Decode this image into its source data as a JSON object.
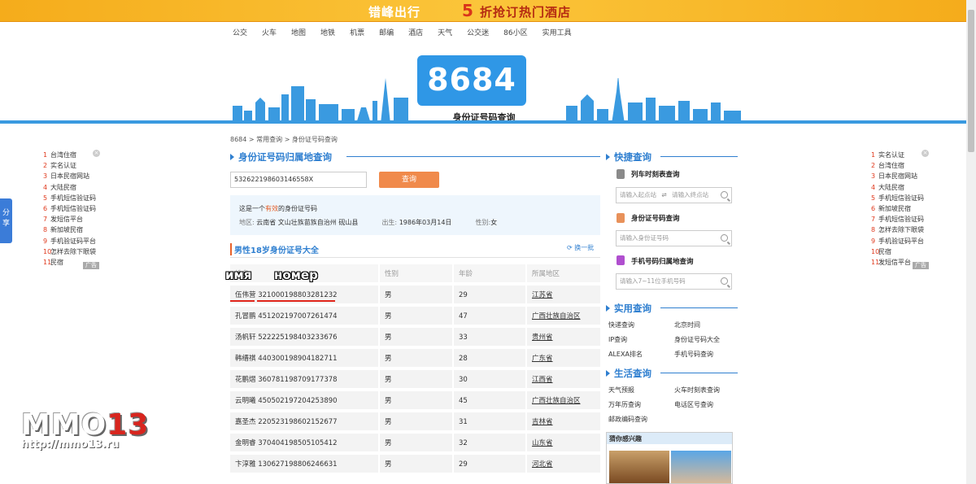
{
  "banner": {
    "part1": "错峰出行",
    "part2": "5",
    "part3": "折抢订热门酒店"
  },
  "nav": [
    "公交",
    "火车",
    "地图",
    "地铁",
    "机票",
    "邮编",
    "酒店",
    "天气",
    "公交迷",
    "86小区",
    "实用工具"
  ],
  "logo": {
    "text": "8684",
    "subtitle": "身份证号码查询"
  },
  "share": {
    "label1": "分",
    "label2": "享"
  },
  "left_panel": {
    "items": [
      "台湾住宿",
      "实名认证",
      "日本民宿网站",
      "大陆民宿",
      "手机短信验证码",
      "手机短信验证码",
      "发短信平台",
      "新加坡民宿",
      "手机验证码平台",
      "怎样去除下眼袋",
      "民宿"
    ],
    "numbers": [
      "1",
      "2",
      "3",
      "4",
      "5",
      "6",
      "7",
      "8",
      "9",
      "10",
      "11"
    ],
    "ad": "广告"
  },
  "right_panel": {
    "items": [
      "实名认证",
      "台湾住宿",
      "日本民宿网站",
      "大陆民宿",
      "手机短信验证码",
      "新加坡民宿",
      "手机短信验证码",
      "怎样去除下眼袋",
      "手机验证码平台",
      "民宿",
      "发短信平台"
    ],
    "numbers": [
      "1",
      "2",
      "3",
      "4",
      "5",
      "6",
      "7",
      "8",
      "9",
      "10",
      "11"
    ],
    "ad": "广告"
  },
  "breadcrumb": "8684 > 常用查询 > 身份证号码查询",
  "main": {
    "section_title": "身份证号码归属地查询",
    "input_value": "532622198603146558X",
    "query_button": "查询",
    "result": {
      "prefix": "这是一个",
      "valid": "有效",
      "suffix": "的身份证号码",
      "region_label": "地区:",
      "region_value": "云南省 文山壮族苗族自治州 砚山县",
      "birth_label": "出生:",
      "birth_value": "1986年03月14日",
      "gender_label": "性别:",
      "gender_value": "女"
    },
    "list_title": "男性18岁身份证号大全",
    "refresh": "换一批",
    "headers": [
      "姓名",
      "性别",
      "年龄",
      "所属地区"
    ],
    "rows": [
      {
        "name": "伍伟营",
        "id": "321000198803281232",
        "gender": "男",
        "age": "29",
        "region": "江苏省"
      },
      {
        "name": "孔冒鹏",
        "id": "451202197007261474",
        "gender": "男",
        "age": "47",
        "region": "广西壮族自治区"
      },
      {
        "name": "汤帆轩",
        "id": "522225198403233676",
        "gender": "男",
        "age": "33",
        "region": "贵州省"
      },
      {
        "name": "韩缙祺",
        "id": "440300198904182711",
        "gender": "男",
        "age": "28",
        "region": "广东省"
      },
      {
        "name": "花鹏熠",
        "id": "360781198709177378",
        "gender": "男",
        "age": "30",
        "region": "江西省"
      },
      {
        "name": "云明曦",
        "id": "450502197204253890",
        "gender": "男",
        "age": "45",
        "region": "广西壮族自治区"
      },
      {
        "name": "嘉圣杰",
        "id": "220523198602152677",
        "gender": "男",
        "age": "31",
        "region": "吉林省"
      },
      {
        "name": "金明睿",
        "id": "370404198505105412",
        "gender": "男",
        "age": "32",
        "region": "山东省"
      },
      {
        "name": "卞淳雅",
        "id": "130627198806246631",
        "gender": "男",
        "age": "29",
        "region": "河北省"
      }
    ]
  },
  "annotations": {
    "name": "имя",
    "number": "номер"
  },
  "quick": {
    "title": "快捷查询",
    "train_label": "列车时刻表查询",
    "train_from": "请输入起点站",
    "train_swap": "⇌",
    "train_to": "请输入终点站",
    "id_label": "身份证号码查询",
    "id_placeholder": "请输入身份证号码",
    "phone_label": "手机号码归属地查询",
    "phone_placeholder": "请输入7~11位手机号码"
  },
  "practical": {
    "title": "实用查询",
    "links": [
      "快递查询",
      "北京时间",
      "IP查询",
      "身份证号码大全",
      "ALEXA排名",
      "手机号码查询"
    ]
  },
  "life": {
    "title": "生活查询",
    "links": [
      "天气预报",
      "火车时刻表查询",
      "万年历查询",
      "电话区号查询",
      "邮政编码查询"
    ]
  },
  "guess": {
    "title": "猜你感兴趣"
  },
  "watermark": {
    "brand": "MMO",
    "num": "13",
    "url": "http://mmo13.ru"
  }
}
